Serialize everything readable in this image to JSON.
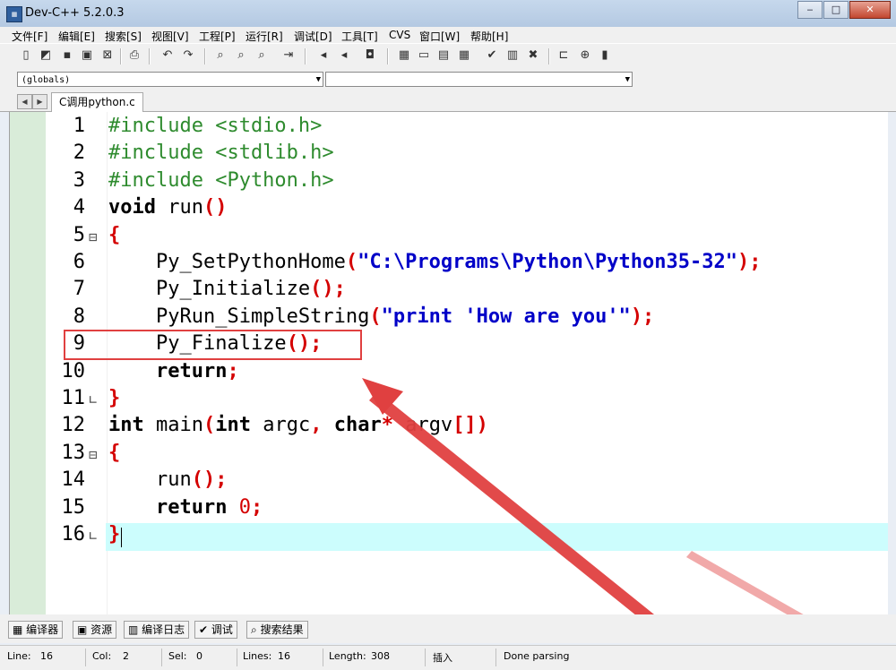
{
  "window": {
    "title": "Dev-C++ 5.2.0.3",
    "icon": "devcpp-app-icon"
  },
  "menu": [
    "文件[F]",
    "编辑[E]",
    "搜索[S]",
    "视图[V]",
    "工程[P]",
    "运行[R]",
    "调试[D]",
    "工具[T]",
    "CVS",
    "窗口[W]",
    "帮助[H]"
  ],
  "combos": {
    "scope": "(globals)",
    "member": ""
  },
  "editor_tab": "C调用python.c",
  "code": {
    "line_numbers": [
      "1",
      "2",
      "3",
      "4",
      "5",
      "6",
      "7",
      "8",
      "9",
      "10",
      "11",
      "12",
      "13",
      "14",
      "15",
      "16"
    ],
    "lines": [
      [
        {
          "t": "#include <stdio.h>",
          "c": "pre"
        }
      ],
      [
        {
          "t": "#include <stdlib.h>",
          "c": "pre"
        }
      ],
      [
        {
          "t": "#include <Python.h>",
          "c": "pre"
        }
      ],
      [
        {
          "t": "void",
          "c": "kw"
        },
        {
          "t": " run",
          "c": "id"
        },
        {
          "t": "()",
          "c": "sym"
        }
      ],
      [
        {
          "t": "{",
          "c": "sym"
        }
      ],
      [
        {
          "t": "    Py_SetPythonHome",
          "c": "id"
        },
        {
          "t": "(",
          "c": "sym"
        },
        {
          "t": "\"C:\\Programs\\Python\\Python35-32\"",
          "c": "str"
        },
        {
          "t": ");",
          "c": "sym"
        }
      ],
      [
        {
          "t": "    Py_Initialize",
          "c": "id"
        },
        {
          "t": "();",
          "c": "sym"
        }
      ],
      [
        {
          "t": "    PyRun_SimpleString",
          "c": "id"
        },
        {
          "t": "(",
          "c": "sym"
        },
        {
          "t": "\"print 'How are you'\"",
          "c": "str"
        },
        {
          "t": ");",
          "c": "sym"
        }
      ],
      [
        {
          "t": "    Py_Finalize",
          "c": "id"
        },
        {
          "t": "();",
          "c": "sym"
        }
      ],
      [
        {
          "t": "    ",
          "c": "id"
        },
        {
          "t": "return",
          "c": "kw"
        },
        {
          "t": ";",
          "c": "sym"
        }
      ],
      [
        {
          "t": "}",
          "c": "sym"
        }
      ],
      [
        {
          "t": "int",
          "c": "kw"
        },
        {
          "t": " main",
          "c": "id"
        },
        {
          "t": "(",
          "c": "sym"
        },
        {
          "t": "int",
          "c": "kw"
        },
        {
          "t": " argc",
          "c": "id"
        },
        {
          "t": ", ",
          "c": "sym"
        },
        {
          "t": "char",
          "c": "kw"
        },
        {
          "t": "*",
          "c": "sym"
        },
        {
          "t": " argv",
          "c": "id"
        },
        {
          "t": "[])",
          "c": "sym"
        }
      ],
      [
        {
          "t": "{",
          "c": "sym"
        }
      ],
      [
        {
          "t": "    run",
          "c": "id"
        },
        {
          "t": "();",
          "c": "sym"
        }
      ],
      [
        {
          "t": "    ",
          "c": "id"
        },
        {
          "t": "return",
          "c": "kw"
        },
        {
          "t": " ",
          "c": "id"
        },
        {
          "t": "0",
          "c": "num"
        },
        {
          "t": ";",
          "c": "sym"
        }
      ],
      [
        {
          "t": "}",
          "c": "sym"
        }
      ]
    ],
    "fold_markers": [
      "⊟",
      "∟",
      "⊟",
      "∟"
    ]
  },
  "bottom_tabs": [
    "编译器",
    "资源",
    "编译日志",
    "调试",
    "搜索结果"
  ],
  "status": {
    "line_label": "Line:",
    "line_value": "16",
    "col_label": "Col:",
    "col_value": "2",
    "sel_label": "Sel:",
    "sel_value": "0",
    "lines_label": "Lines:",
    "lines_value": "16",
    "length_label": "Length:",
    "length_value": "308",
    "mode": "插入",
    "message": "Done parsing"
  },
  "colors": {
    "highlight_box": "#e04040",
    "arrow": "#e04040",
    "current_line": "#ccfdfd"
  }
}
